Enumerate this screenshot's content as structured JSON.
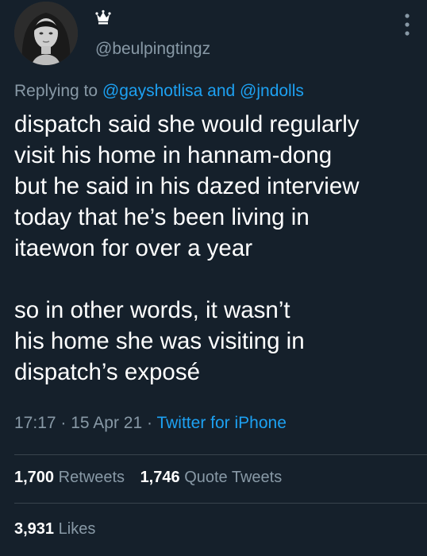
{
  "user": {
    "handle": "@beulpingtingz",
    "badge_icon": "crown-icon"
  },
  "reply": {
    "prefix": "Replying to",
    "user1": "@gayshotlisa",
    "joiner": "and",
    "user2": "@jndolls"
  },
  "tweet": {
    "paragraph1": "dispatch said she would regularly\nvisit his home in hannam-dong\nbut he said in his dazed interview\ntoday that he’s been living in\nitaewon for over a year",
    "paragraph2": "so in other words, it wasn’t\nhis home she was visiting in\ndispatch’s exposé"
  },
  "meta": {
    "time": "17:17",
    "sep1": "·",
    "date": "15 Apr 21",
    "sep2": "·",
    "source": "Twitter for iPhone"
  },
  "stats": {
    "retweets_count": "1,700",
    "retweets_label": "Retweets",
    "quotes_count": "1,746",
    "quotes_label": "Quote Tweets",
    "likes_count": "3,931",
    "likes_label": "Likes"
  },
  "colors": {
    "background": "#15202b",
    "text": "#ffffff",
    "secondary": "#8899a6",
    "link": "#1da1f2",
    "divider": "#38444d"
  }
}
